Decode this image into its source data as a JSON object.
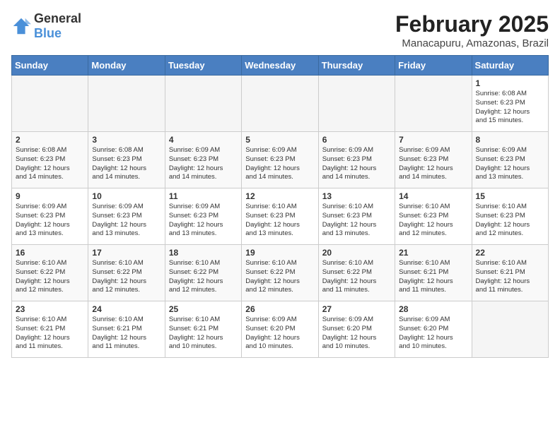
{
  "header": {
    "logo_general": "General",
    "logo_blue": "Blue",
    "title": "February 2025",
    "subtitle": "Manacapuru, Amazonas, Brazil"
  },
  "weekdays": [
    "Sunday",
    "Monday",
    "Tuesday",
    "Wednesday",
    "Thursday",
    "Friday",
    "Saturday"
  ],
  "weeks": [
    [
      {
        "day": "",
        "info": ""
      },
      {
        "day": "",
        "info": ""
      },
      {
        "day": "",
        "info": ""
      },
      {
        "day": "",
        "info": ""
      },
      {
        "day": "",
        "info": ""
      },
      {
        "day": "",
        "info": ""
      },
      {
        "day": "1",
        "info": "Sunrise: 6:08 AM\nSunset: 6:23 PM\nDaylight: 12 hours\nand 15 minutes."
      }
    ],
    [
      {
        "day": "2",
        "info": "Sunrise: 6:08 AM\nSunset: 6:23 PM\nDaylight: 12 hours\nand 14 minutes."
      },
      {
        "day": "3",
        "info": "Sunrise: 6:08 AM\nSunset: 6:23 PM\nDaylight: 12 hours\nand 14 minutes."
      },
      {
        "day": "4",
        "info": "Sunrise: 6:09 AM\nSunset: 6:23 PM\nDaylight: 12 hours\nand 14 minutes."
      },
      {
        "day": "5",
        "info": "Sunrise: 6:09 AM\nSunset: 6:23 PM\nDaylight: 12 hours\nand 14 minutes."
      },
      {
        "day": "6",
        "info": "Sunrise: 6:09 AM\nSunset: 6:23 PM\nDaylight: 12 hours\nand 14 minutes."
      },
      {
        "day": "7",
        "info": "Sunrise: 6:09 AM\nSunset: 6:23 PM\nDaylight: 12 hours\nand 14 minutes."
      },
      {
        "day": "8",
        "info": "Sunrise: 6:09 AM\nSunset: 6:23 PM\nDaylight: 12 hours\nand 13 minutes."
      }
    ],
    [
      {
        "day": "9",
        "info": "Sunrise: 6:09 AM\nSunset: 6:23 PM\nDaylight: 12 hours\nand 13 minutes."
      },
      {
        "day": "10",
        "info": "Sunrise: 6:09 AM\nSunset: 6:23 PM\nDaylight: 12 hours\nand 13 minutes."
      },
      {
        "day": "11",
        "info": "Sunrise: 6:09 AM\nSunset: 6:23 PM\nDaylight: 12 hours\nand 13 minutes."
      },
      {
        "day": "12",
        "info": "Sunrise: 6:10 AM\nSunset: 6:23 PM\nDaylight: 12 hours\nand 13 minutes."
      },
      {
        "day": "13",
        "info": "Sunrise: 6:10 AM\nSunset: 6:23 PM\nDaylight: 12 hours\nand 13 minutes."
      },
      {
        "day": "14",
        "info": "Sunrise: 6:10 AM\nSunset: 6:23 PM\nDaylight: 12 hours\nand 12 minutes."
      },
      {
        "day": "15",
        "info": "Sunrise: 6:10 AM\nSunset: 6:23 PM\nDaylight: 12 hours\nand 12 minutes."
      }
    ],
    [
      {
        "day": "16",
        "info": "Sunrise: 6:10 AM\nSunset: 6:22 PM\nDaylight: 12 hours\nand 12 minutes."
      },
      {
        "day": "17",
        "info": "Sunrise: 6:10 AM\nSunset: 6:22 PM\nDaylight: 12 hours\nand 12 minutes."
      },
      {
        "day": "18",
        "info": "Sunrise: 6:10 AM\nSunset: 6:22 PM\nDaylight: 12 hours\nand 12 minutes."
      },
      {
        "day": "19",
        "info": "Sunrise: 6:10 AM\nSunset: 6:22 PM\nDaylight: 12 hours\nand 12 minutes."
      },
      {
        "day": "20",
        "info": "Sunrise: 6:10 AM\nSunset: 6:22 PM\nDaylight: 12 hours\nand 11 minutes."
      },
      {
        "day": "21",
        "info": "Sunrise: 6:10 AM\nSunset: 6:21 PM\nDaylight: 12 hours\nand 11 minutes."
      },
      {
        "day": "22",
        "info": "Sunrise: 6:10 AM\nSunset: 6:21 PM\nDaylight: 12 hours\nand 11 minutes."
      }
    ],
    [
      {
        "day": "23",
        "info": "Sunrise: 6:10 AM\nSunset: 6:21 PM\nDaylight: 12 hours\nand 11 minutes."
      },
      {
        "day": "24",
        "info": "Sunrise: 6:10 AM\nSunset: 6:21 PM\nDaylight: 12 hours\nand 11 minutes."
      },
      {
        "day": "25",
        "info": "Sunrise: 6:10 AM\nSunset: 6:21 PM\nDaylight: 12 hours\nand 10 minutes."
      },
      {
        "day": "26",
        "info": "Sunrise: 6:09 AM\nSunset: 6:20 PM\nDaylight: 12 hours\nand 10 minutes."
      },
      {
        "day": "27",
        "info": "Sunrise: 6:09 AM\nSunset: 6:20 PM\nDaylight: 12 hours\nand 10 minutes."
      },
      {
        "day": "28",
        "info": "Sunrise: 6:09 AM\nSunset: 6:20 PM\nDaylight: 12 hours\nand 10 minutes."
      },
      {
        "day": "",
        "info": ""
      }
    ]
  ]
}
